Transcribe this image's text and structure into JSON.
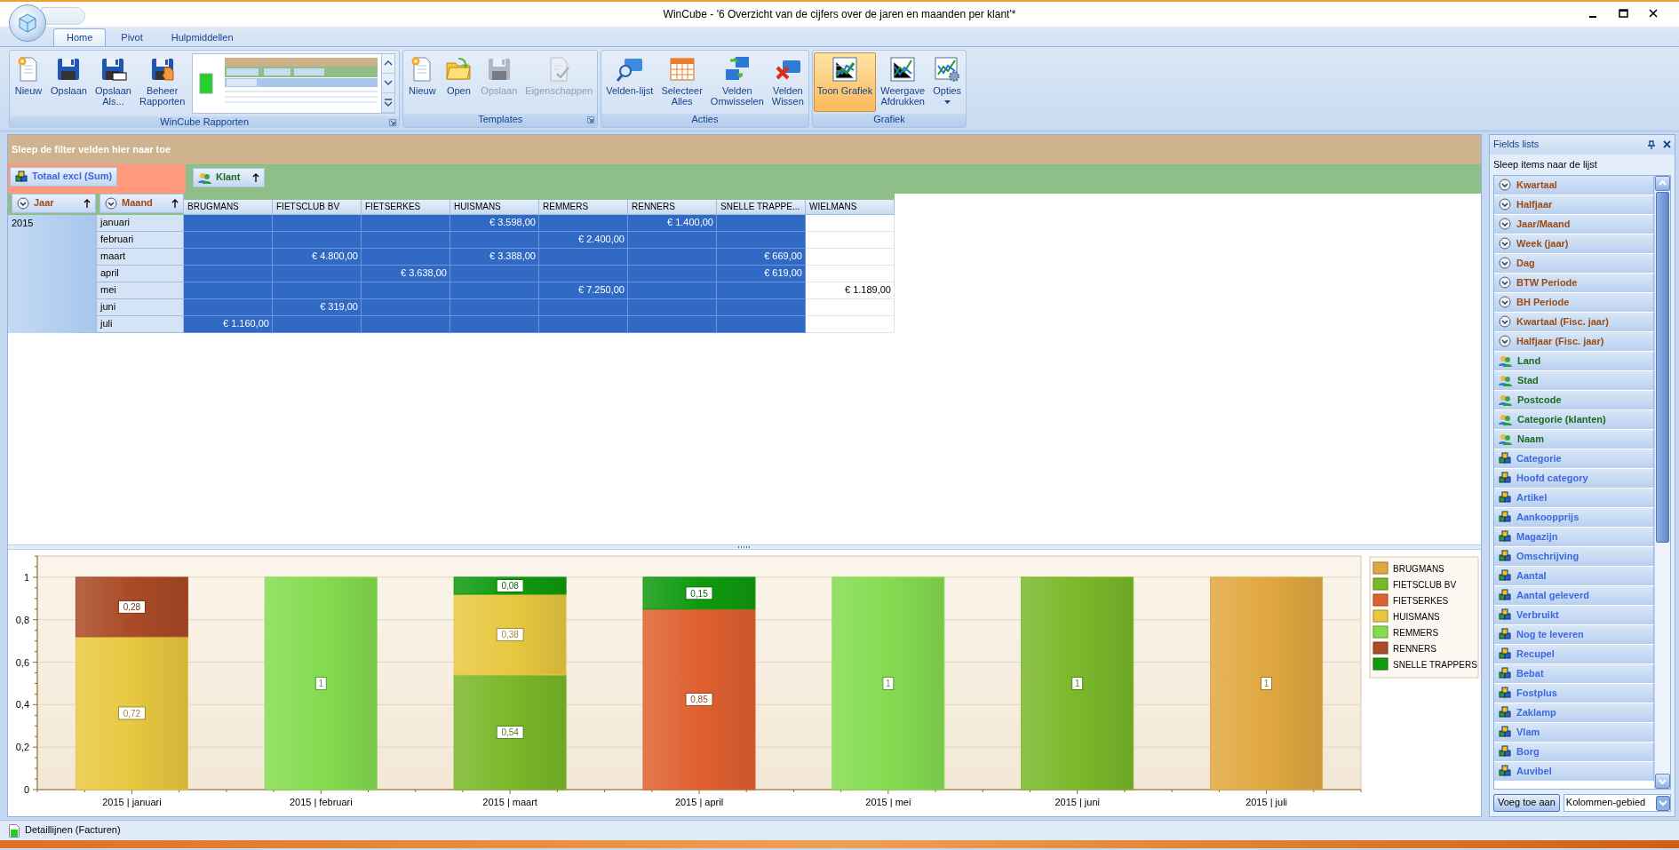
{
  "window": {
    "title": "WinCube - '6 Overzicht van de cijfers over de jaren en maanden per klant'*"
  },
  "ribbon": {
    "tabs": [
      {
        "label": "Home",
        "selected": true
      },
      {
        "label": "Pivot",
        "selected": false
      },
      {
        "label": "Hulpmiddellen",
        "selected": false
      }
    ],
    "groups": [
      {
        "label": "WinCube Rapporten",
        "launcher": true,
        "items": [
          {
            "kind": "button",
            "lines": [
              "Nieuw"
            ],
            "disabled": false,
            "pressed": false
          },
          {
            "kind": "button",
            "lines": [
              "Opslaan"
            ],
            "disabled": false,
            "pressed": false
          },
          {
            "kind": "button",
            "lines": [
              "Opslaan",
              "Als..."
            ],
            "disabled": false,
            "pressed": false
          },
          {
            "kind": "button",
            "lines": [
              "Beheer",
              "Rapporten"
            ],
            "disabled": false,
            "pressed": false
          },
          {
            "kind": "gallery"
          }
        ]
      },
      {
        "label": "Templates",
        "launcher": true,
        "items": [
          {
            "kind": "button",
            "lines": [
              "Nieuw"
            ],
            "disabled": false,
            "pressed": false
          },
          {
            "kind": "button",
            "lines": [
              "Open"
            ],
            "disabled": false,
            "pressed": false
          },
          {
            "kind": "button",
            "lines": [
              "Opslaan"
            ],
            "disabled": true,
            "pressed": false
          },
          {
            "kind": "button",
            "lines": [
              "Eigenschappen"
            ],
            "disabled": true,
            "pressed": false
          }
        ]
      },
      {
        "label": "Acties",
        "launcher": false,
        "items": [
          {
            "kind": "button",
            "lines": [
              "Velden-lijst"
            ],
            "disabled": false,
            "pressed": false
          },
          {
            "kind": "button",
            "lines": [
              "Selecteer",
              "Alles"
            ],
            "disabled": false,
            "pressed": false
          },
          {
            "kind": "button",
            "lines": [
              "Velden",
              "Omwisselen"
            ],
            "disabled": false,
            "pressed": false
          },
          {
            "kind": "button",
            "lines": [
              "Velden",
              "Wissen"
            ],
            "disabled": false,
            "pressed": false
          }
        ]
      },
      {
        "label": "Grafiek",
        "launcher": false,
        "items": [
          {
            "kind": "button",
            "lines": [
              "Toon Grafiek"
            ],
            "disabled": false,
            "pressed": true
          },
          {
            "kind": "button",
            "lines": [
              "Weergave",
              "Afdrukken"
            ],
            "disabled": false,
            "pressed": false
          },
          {
            "kind": "dropdown",
            "lines": [
              "Opties"
            ],
            "disabled": false,
            "pressed": false
          }
        ]
      }
    ]
  },
  "pivot": {
    "filter_area": "Sleep de filter velden hier naar toe",
    "data_field": "Totaal excl (Sum)",
    "column_field": "Klant",
    "row_fields": [
      "Jaar",
      "Maand"
    ],
    "columns": [
      {
        "label": "BRUGMANS",
        "selected": true
      },
      {
        "label": "FIETSCLUB BV",
        "selected": true
      },
      {
        "label": "FIETSERKES",
        "selected": true
      },
      {
        "label": "HUISMANS",
        "selected": true
      },
      {
        "label": "REMMERS",
        "selected": true
      },
      {
        "label": "RENNERS",
        "selected": true
      },
      {
        "label": "SNELLE TRAPPE...",
        "selected": true
      },
      {
        "label": "WIELMANS",
        "selected": false
      }
    ],
    "year": "2015",
    "rows": [
      {
        "label": "januari",
        "cells": [
          null,
          null,
          null,
          "€ 3.598,00",
          null,
          "€ 1.400,00",
          null,
          null
        ]
      },
      {
        "label": "februari",
        "cells": [
          null,
          null,
          null,
          null,
          "€ 2.400,00",
          null,
          null,
          null
        ]
      },
      {
        "label": "maart",
        "cells": [
          null,
          "€ 4.800,00",
          null,
          "€ 3.388,00",
          null,
          null,
          "€ 669,00",
          null
        ]
      },
      {
        "label": "april",
        "cells": [
          null,
          null,
          "€ 3.638,00",
          null,
          null,
          null,
          "€ 619,00",
          null
        ]
      },
      {
        "label": "mei",
        "cells": [
          null,
          null,
          null,
          null,
          "€ 7.250,00",
          null,
          null,
          "€ 1.189,00"
        ]
      },
      {
        "label": "juni",
        "cells": [
          null,
          "€ 319,00",
          null,
          null,
          null,
          null,
          null,
          null
        ]
      },
      {
        "label": "juli",
        "cells": [
          "€ 1.160,00",
          null,
          null,
          null,
          null,
          null,
          null,
          null
        ]
      }
    ]
  },
  "chart": {
    "chart_data": {
      "type": "bar",
      "stacked": true,
      "grid": true,
      "legend": true,
      "categories": [
        "2015 | januari",
        "2015 | februari",
        "2015 | maart",
        "2015 | april",
        "2015 | mei",
        "2015 | juni",
        "2015 | juli"
      ],
      "ylim": [
        0,
        1.1
      ],
      "yticks": [
        {
          "value": 0,
          "label": "0"
        },
        {
          "value": 0.2,
          "label": "0,2"
        },
        {
          "value": 0.4,
          "label": "0,4"
        },
        {
          "value": 0.6,
          "label": "0,6"
        },
        {
          "value": 0.8,
          "label": "0,8"
        },
        {
          "value": 1,
          "label": "1"
        }
      ],
      "series": [
        {
          "name": "BRUGMANS",
          "color": "#e0a840",
          "values": [
            null,
            null,
            null,
            null,
            null,
            null,
            1
          ],
          "value_labels": [
            null,
            null,
            null,
            null,
            null,
            null,
            "1"
          ]
        },
        {
          "name": "FIETSCLUB BV",
          "color": "#7ab82a",
          "values": [
            null,
            null,
            0.54,
            null,
            null,
            1,
            null
          ],
          "value_labels": [
            null,
            null,
            "0,54",
            null,
            null,
            "1",
            null
          ]
        },
        {
          "name": "FIETSERKES",
          "color": "#e06030",
          "values": [
            null,
            null,
            null,
            0.85,
            null,
            null,
            null
          ],
          "value_labels": [
            null,
            null,
            null,
            "0,85",
            null,
            null,
            null
          ]
        },
        {
          "name": "HUISMANS",
          "color": "#e8c840",
          "values": [
            0.72,
            null,
            0.38,
            null,
            null,
            null,
            null
          ],
          "value_labels": [
            "0,72",
            null,
            "0,38",
            null,
            null,
            null,
            null
          ]
        },
        {
          "name": "REMMERS",
          "color": "#84dc50",
          "values": [
            null,
            1,
            null,
            null,
            1,
            null,
            null
          ],
          "value_labels": [
            null,
            "1",
            null,
            null,
            "1",
            null,
            null
          ]
        },
        {
          "name": "RENNERS",
          "color": "#aa4a26",
          "values": [
            0.28,
            null,
            null,
            null,
            null,
            null,
            null
          ],
          "value_labels": [
            "0,28",
            null,
            null,
            null,
            null,
            null,
            null
          ]
        },
        {
          "name": "SNELLE TRAPPERS",
          "color": "#109a10",
          "values": [
            null,
            null,
            0.08,
            0.15,
            null,
            null,
            null
          ],
          "value_labels": [
            null,
            null,
            "0,08",
            "0,15",
            null,
            null,
            null
          ]
        }
      ]
    }
  },
  "fields_panel": {
    "title": "Fields lists",
    "hint": "Sleep items naar de lijst",
    "fields": [
      {
        "label": "Kwartaal",
        "kind": "period"
      },
      {
        "label": "Halfjaar",
        "kind": "period"
      },
      {
        "label": "Jaar/Maand",
        "kind": "period"
      },
      {
        "label": "Week (jaar)",
        "kind": "period"
      },
      {
        "label": "Dag",
        "kind": "period"
      },
      {
        "label": "BTW Periode",
        "kind": "period"
      },
      {
        "label": "BH Periode",
        "kind": "period"
      },
      {
        "label": "Kwartaal (Fisc. jaar)",
        "kind": "period"
      },
      {
        "label": "Halfjaar (Fisc. jaar)",
        "kind": "period"
      },
      {
        "label": "Land",
        "kind": "customer"
      },
      {
        "label": "Stad",
        "kind": "customer"
      },
      {
        "label": "Postcode",
        "kind": "customer"
      },
      {
        "label": "Categorie (klanten)",
        "kind": "customer"
      },
      {
        "label": "Naam",
        "kind": "customer"
      },
      {
        "label": "Categorie",
        "kind": "measure"
      },
      {
        "label": "Hoofd category",
        "kind": "measure"
      },
      {
        "label": "Artikel",
        "kind": "measure"
      },
      {
        "label": "Aankoopprijs",
        "kind": "measure"
      },
      {
        "label": "Magazijn",
        "kind": "measure"
      },
      {
        "label": "Omschrijving",
        "kind": "measure"
      },
      {
        "label": "Aantal",
        "kind": "measure"
      },
      {
        "label": "Aantal geleverd",
        "kind": "measure"
      },
      {
        "label": "Verbruikt",
        "kind": "measure"
      },
      {
        "label": "Nog te leveren",
        "kind": "measure"
      },
      {
        "label": "Recupel",
        "kind": "measure"
      },
      {
        "label": "Bebat",
        "kind": "measure"
      },
      {
        "label": "Fostplus",
        "kind": "measure"
      },
      {
        "label": "Zaklamp",
        "kind": "measure"
      },
      {
        "label": "Vlam",
        "kind": "measure"
      },
      {
        "label": "Borg",
        "kind": "measure"
      },
      {
        "label": "Auvibel",
        "kind": "measure"
      }
    ],
    "add_button": "Voeg toe aan",
    "target": {
      "value": "Kolommen-gebied"
    }
  },
  "status_bar": {
    "label": "Detaillijnen (Facturen)"
  }
}
